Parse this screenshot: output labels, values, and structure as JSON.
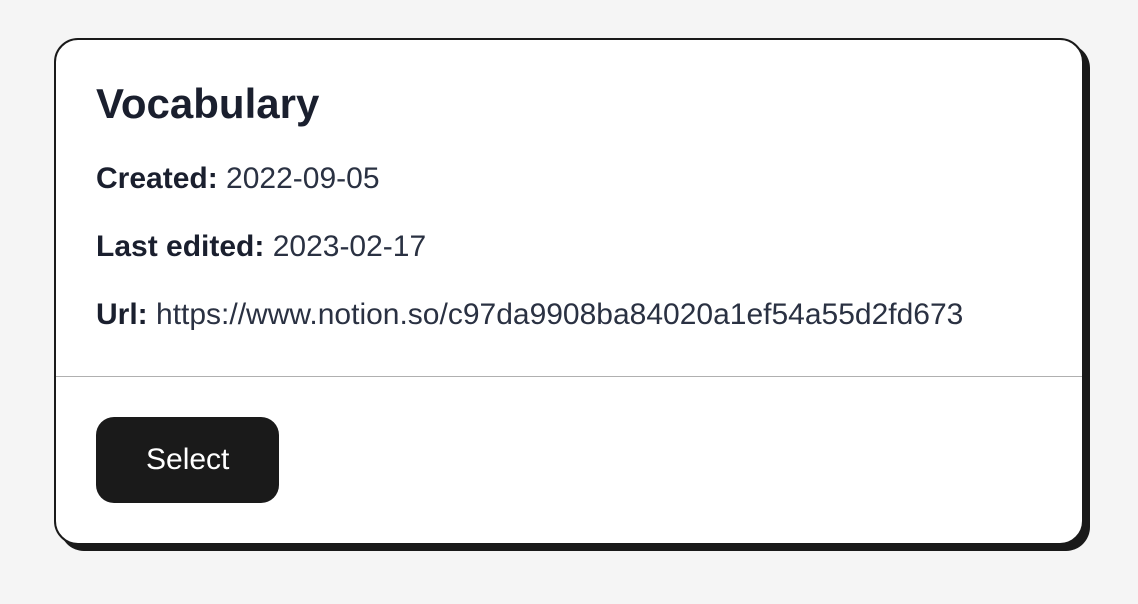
{
  "card": {
    "title": "Vocabulary",
    "created_label": "Created:",
    "created_value": "2022-09-05",
    "edited_label": "Last edited:",
    "edited_value": "2023-02-17",
    "url_label": "Url:",
    "url_value": "https://www.notion.so/c97da9908ba84020a1ef54a55d2fd673",
    "select_button": "Select"
  }
}
